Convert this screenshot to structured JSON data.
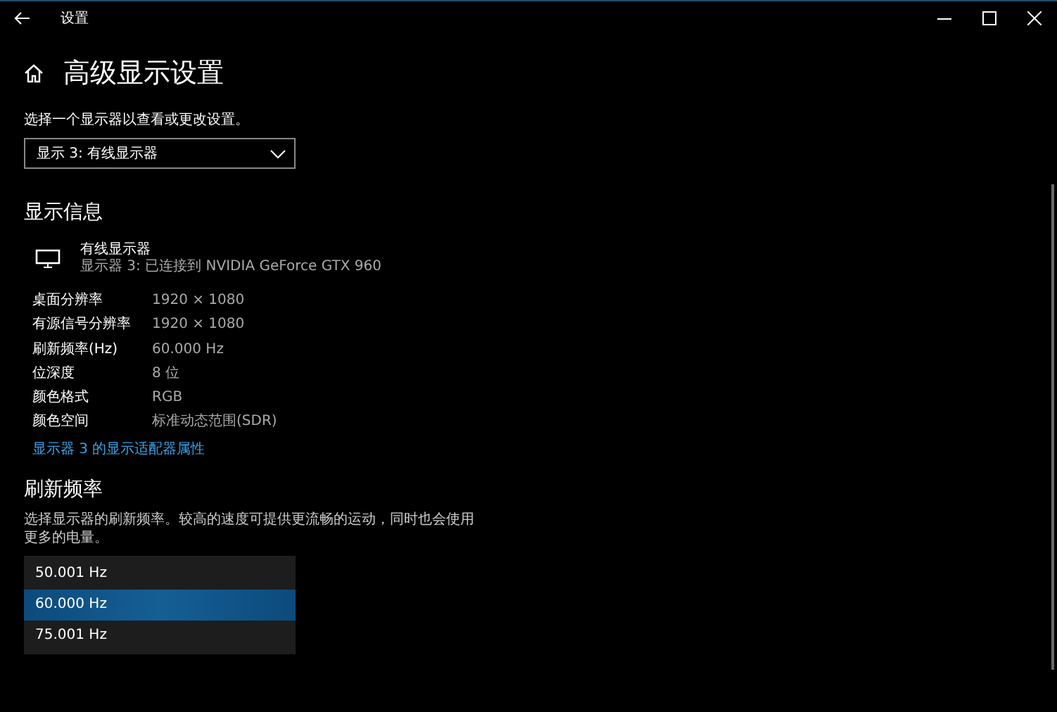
{
  "window": {
    "title": "设置"
  },
  "page_title": "高级显示设置",
  "display_picker": {
    "label": "选择一个显示器以查看或更改设置。",
    "value": "显示 3: 有线显示器"
  },
  "display_info": {
    "heading": "显示信息",
    "monitor_name": "有线显示器",
    "monitor_detail": "显示器 3: 已连接到 NVIDIA GeForce GTX 960",
    "rows": [
      {
        "label": "桌面分辨率",
        "value": "1920 × 1080"
      },
      {
        "label": "有源信号分辨率",
        "value": "1920 × 1080"
      },
      {
        "label": "刷新频率(Hz)",
        "value": "60.000 Hz"
      },
      {
        "label": "位深度",
        "value": "8 位"
      },
      {
        "label": "颜色格式",
        "value": "RGB"
      },
      {
        "label": "颜色空间",
        "value": "标准动态范围(SDR)"
      }
    ],
    "link": "显示器 3 的显示适配器属性"
  },
  "refresh_rate": {
    "heading": "刷新频率",
    "description": "选择显示器的刷新频率。较高的速度可提供更流畅的运动，同时也会使用更多的电量。",
    "options": [
      {
        "label": "50.001 Hz",
        "selected": false
      },
      {
        "label": "60.000 Hz",
        "selected": true
      },
      {
        "label": "75.001 Hz",
        "selected": false
      }
    ]
  }
}
